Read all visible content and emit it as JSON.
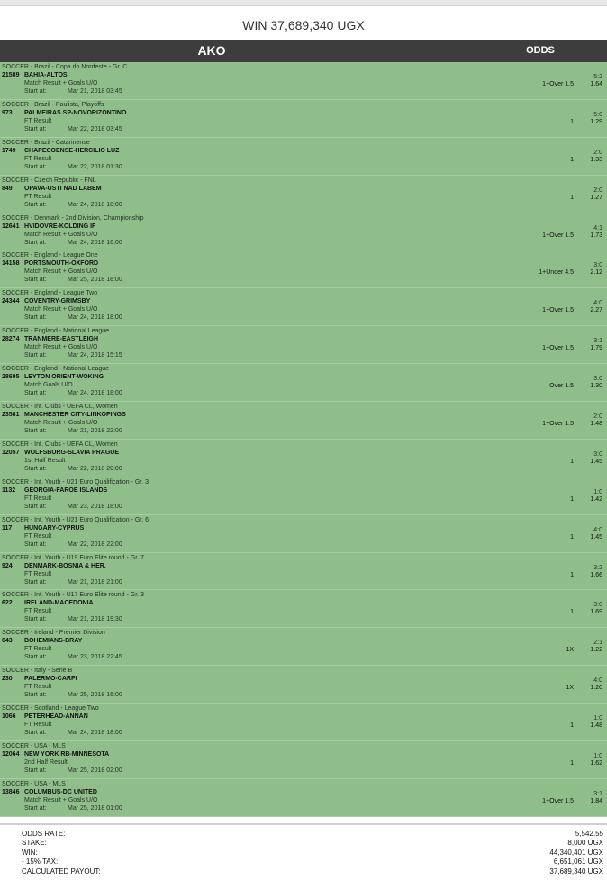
{
  "header": {
    "title": "WIN 37,689,340 UGX",
    "col_ako": "AKO",
    "col_odds": "ODDS"
  },
  "start_label": "Start at:",
  "bets": [
    {
      "competition": "SOCCER - Brazil - Copa do Nordeste - Gr. C",
      "code": "21589",
      "match": "BAHIA-ALTOS",
      "market": "Match Result + Goals U/O",
      "start": "Mar 21, 2018 03:45",
      "pick": "1+Over 1.5",
      "score": "5:2",
      "odds": "1.64"
    },
    {
      "competition": "SOCCER - Brazil - Paulista, Playoffs",
      "code": "973",
      "match": "PALMEIRAS SP-NOVORIZONTINO",
      "market": "FT Result",
      "start": "Mar 22, 2018 03:45",
      "pick": "1",
      "score": "5:0",
      "odds": "1.29"
    },
    {
      "competition": "SOCCER - Brazil - Catarinense",
      "code": "1749",
      "match": "CHAPECOENSE-HERCILIO LUZ",
      "market": "FT Result",
      "start": "Mar 22, 2018 01:30",
      "pick": "1",
      "score": "2:0",
      "odds": "1.33"
    },
    {
      "competition": "SOCCER - Czech Republic - FNL",
      "code": "849",
      "match": "OPAVA-USTI NAD LABEM",
      "market": "FT Result",
      "start": "Mar 24, 2018 18:00",
      "pick": "1",
      "score": "2:0",
      "odds": "1.27"
    },
    {
      "competition": "SOCCER - Denmark - 2nd Division, Championship",
      "code": "12641",
      "match": "HVIDOVRE-KOLDING IF",
      "market": "Match Result + Goals U/O",
      "start": "Mar 24, 2018 16:00",
      "pick": "1+Over 1.5",
      "score": "4:1",
      "odds": "1.73"
    },
    {
      "competition": "SOCCER - England - League One",
      "code": "14158",
      "match": "PORTSMOUTH-OXFORD",
      "market": "Match Result + Goals U/O",
      "start": "Mar 25, 2018 18:00",
      "pick": "1+Under 4.5",
      "score": "3:0",
      "odds": "2.12"
    },
    {
      "competition": "SOCCER - England - League Two",
      "code": "24344",
      "match": "COVENTRY-GRIMSBY",
      "market": "Match Result + Goals U/O",
      "start": "Mar 24, 2018 18:00",
      "pick": "1+Over 1.5",
      "score": "4:0",
      "odds": "2.27"
    },
    {
      "competition": "SOCCER - England - National League",
      "code": "28274",
      "match": "TRANMERE-EASTLEIGH",
      "market": "Match Result + Goals U/O",
      "start": "Mar 24, 2018 15:15",
      "pick": "1+Over 1.5",
      "score": "3:1",
      "odds": "1.79"
    },
    {
      "competition": "SOCCER - England - National League",
      "code": "28695",
      "match": "LEYTON ORIENT-WOKING",
      "market": "Match Goals U/O",
      "start": "Mar 24, 2018 18:00",
      "pick": "Over 1.5",
      "score": "3:0",
      "odds": "1.30"
    },
    {
      "competition": "SOCCER - Int. Clubs - UEFA CL, Women",
      "code": "23581",
      "match": "MANCHESTER CITY-LINKOPINGS",
      "market": "Match Result + Goals U/O",
      "start": "Mar 21, 2018 22:00",
      "pick": "1+Over 1.5",
      "score": "2:0",
      "odds": "1.48"
    },
    {
      "competition": "SOCCER - Int. Clubs - UEFA CL, Women",
      "code": "12057",
      "match": "WOLFSBURG-SLAVIA PRAGUE",
      "market": "1st Half Result",
      "start": "Mar 22, 2018 20:00",
      "pick": "1",
      "score": "3:0",
      "odds": "1.45"
    },
    {
      "competition": "SOCCER - Int. Youth - U21 Euro Qualification - Gr. 3",
      "code": "1132",
      "match": "GEORGIA-FAROE ISLANDS",
      "market": "FT Result",
      "start": "Mar 23, 2018 18:00",
      "pick": "1",
      "score": "1:0",
      "odds": "1.42"
    },
    {
      "competition": "SOCCER - Int. Youth - U21 Euro Qualification - Gr. 6",
      "code": "117",
      "match": "HUNGARY-CYPRUS",
      "market": "FT Result",
      "start": "Mar 22, 2018 22:00",
      "pick": "1",
      "score": "4:0",
      "odds": "1.45"
    },
    {
      "competition": "SOCCER - Int. Youth - U19 Euro Elite round - Gr. 7",
      "code": "924",
      "match": "DENMARK-BOSNIA & HER.",
      "market": "FT Result",
      "start": "Mar 21, 2018 21:00",
      "pick": "1",
      "score": "3:2",
      "odds": "1.66"
    },
    {
      "competition": "SOCCER - Int. Youth - U17 Euro Elite round - Gr. 3",
      "code": "622",
      "match": "IRELAND-MACEDONIA",
      "market": "FT Result",
      "start": "Mar 21, 2018 19:30",
      "pick": "1",
      "score": "3:0",
      "odds": "1.69"
    },
    {
      "competition": "SOCCER - Ireland - Premier Division",
      "code": "643",
      "match": "BOHEMIANS-BRAY",
      "market": "FT Result",
      "start": "Mar 23, 2018 22:45",
      "pick": "1X",
      "score": "2:1",
      "odds": "1.22"
    },
    {
      "competition": "SOCCER - Italy - Serie B",
      "code": "230",
      "match": "PALERMO-CARPI",
      "market": "FT Result",
      "start": "Mar 25, 2018 16:00",
      "pick": "1X",
      "score": "4:0",
      "odds": "1.20"
    },
    {
      "competition": "SOCCER - Scotland - League Two",
      "code": "1066",
      "match": "PETERHEAD-ANNAN",
      "market": "FT Result",
      "start": "Mar 24, 2018 18:00",
      "pick": "1",
      "score": "1:0",
      "odds": "1.48"
    },
    {
      "competition": "SOCCER - USA - MLS",
      "code": "12064",
      "match": "NEW YORK RB-MINNESOTA",
      "market": "2nd Half Result",
      "start": "Mar 25, 2018 02:00",
      "pick": "1",
      "score": "1:0",
      "odds": "1.62"
    },
    {
      "competition": "SOCCER - USA - MLS",
      "code": "13846",
      "match": "COLUMBUS-DC UNITED",
      "market": "Match Result + Goals U/O",
      "start": "Mar 25, 2018 01:00",
      "pick": "1+Over 1.5",
      "score": "3:1",
      "odds": "1.84"
    }
  ],
  "summary": [
    {
      "label": "ODDS RATE:",
      "value": "5,542.55"
    },
    {
      "label": "STAKE:",
      "value": "8,000 UGX"
    },
    {
      "label": "WIN:",
      "value": "44,340,401 UGX"
    },
    {
      "label": "- 15% TAX:",
      "value": "6,651,061 UGX"
    },
    {
      "label": "CALCULATED PAYOUT:",
      "value": "37,689,340 UGX"
    }
  ]
}
